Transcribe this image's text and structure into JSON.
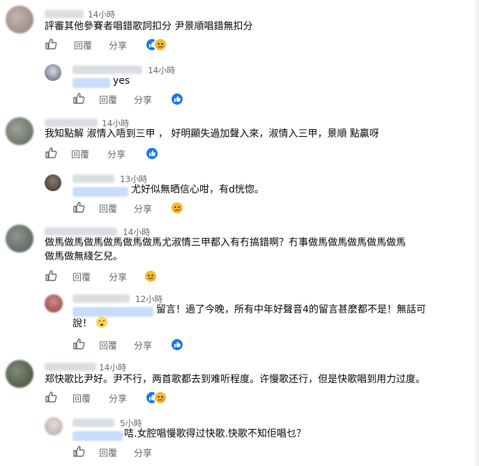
{
  "actions": {
    "like_label": "",
    "reply_label": "回覆",
    "share_label": "分享"
  },
  "comments": [
    {
      "time": "14小時",
      "text": "評審其他參賽者唱錯歌詞扣分 尹景順唱錯無扣分"
    },
    {
      "time": "14小時",
      "text": "yes"
    },
    {
      "time": "14小時",
      "text": "我知點解 淑情入唔到三甲 ， 好明顯失過加聲入來，淑情入三甲，景順 點贏呀"
    },
    {
      "time": "13小時",
      "text": "尤好似無晒信心咁，有d恍惚。"
    },
    {
      "time": "14小時",
      "line1": "做馬做馬做馬做馬做馬做馬尤淑情三甲都入有冇搞錯啊？冇事做馬做馬做馬做馬做馬",
      "line2": "做馬做無綫乞兒。"
    },
    {
      "time": "12小時",
      "line1": "留言！過了今晚，所有中年好聲音4的留言甚麼都不是！無話可",
      "line2": "說！"
    },
    {
      "time": "14小時",
      "text": "郑快歌比尹好。尹不行，两首歌都去到难听程度。许慢歌还行，但是快歌唱到用力过度。"
    },
    {
      "time": "5小時",
      "text": "咭.女腔唱慢歌得过快歌.快歌不知佢唱乜？"
    }
  ],
  "colors": {
    "link_blue": "#1877f2",
    "muted_gray": "#65676b",
    "text": "#050505"
  }
}
